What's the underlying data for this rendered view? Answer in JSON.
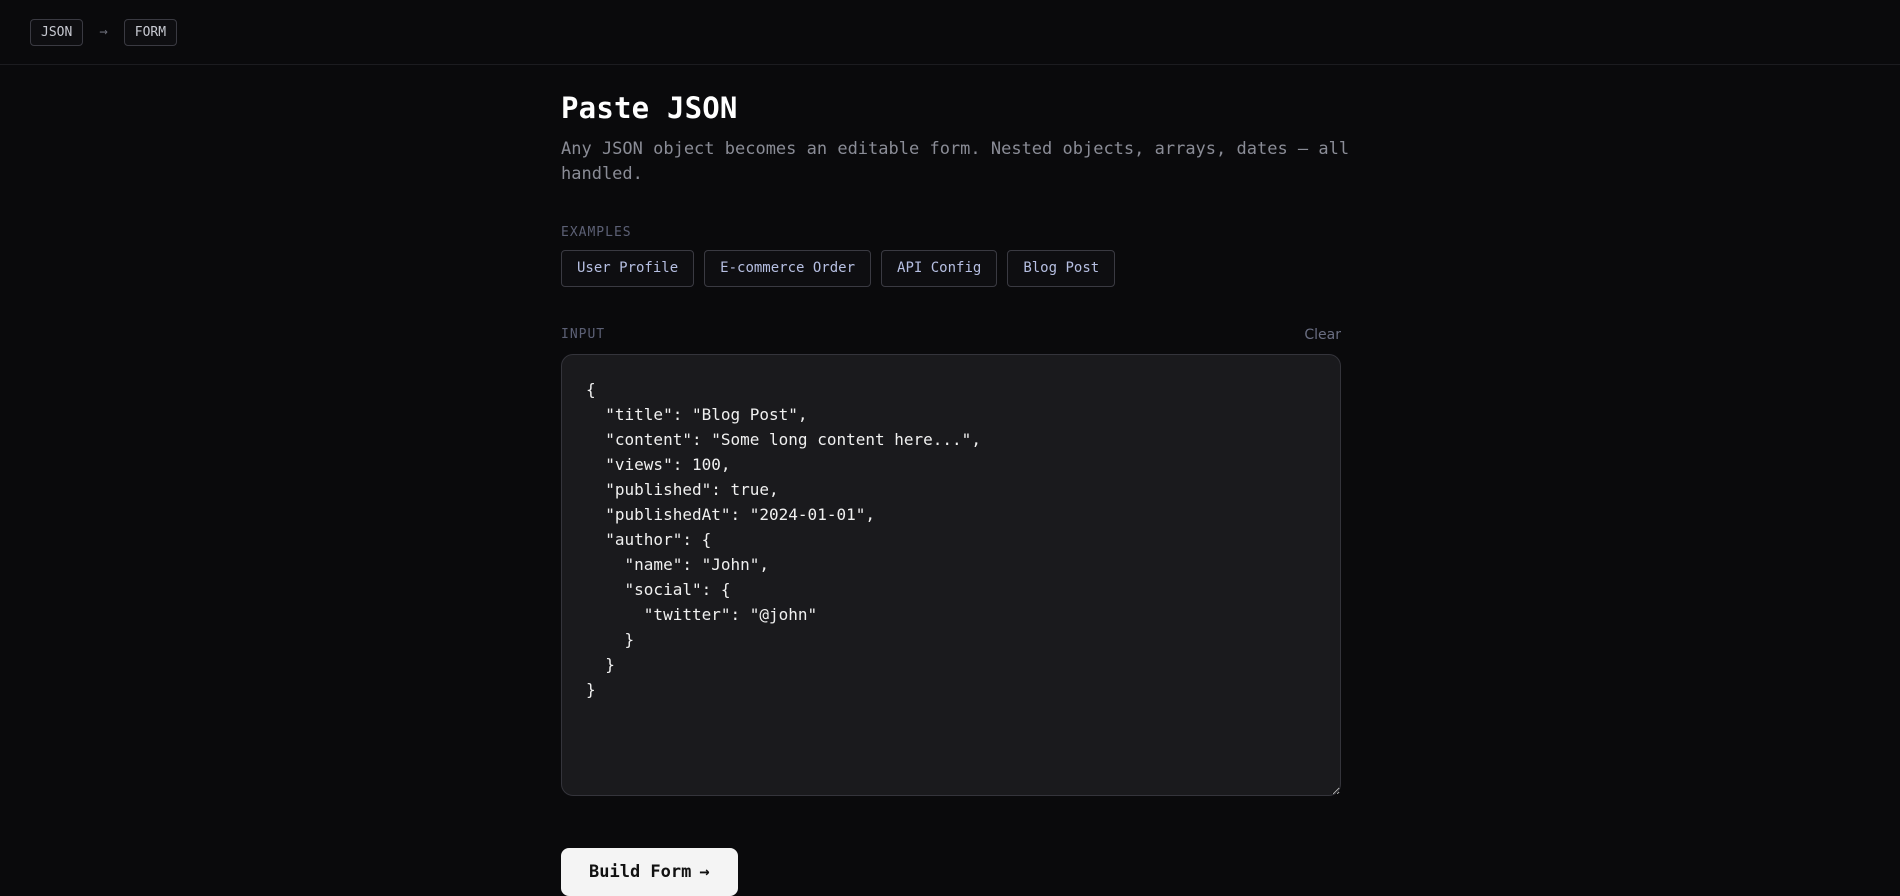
{
  "header": {
    "tag_left": "JSON",
    "arrow": "→",
    "tag_right": "FORM"
  },
  "main": {
    "title": "Paste JSON",
    "subtitle": "Any JSON object becomes an editable form. Nested objects, arrays, dates — all handled.",
    "examples_label": "EXAMPLES",
    "examples": [
      {
        "label": "User Profile"
      },
      {
        "label": "E-commerce Order"
      },
      {
        "label": "API Config"
      },
      {
        "label": "Blog Post"
      }
    ],
    "input_label": "INPUT",
    "clear_label": "Clear",
    "input_value": "{\n  \"title\": \"Blog Post\",\n  \"content\": \"Some long content here...\",\n  \"views\": 100,\n  \"published\": true,\n  \"publishedAt\": \"2024-01-01\",\n  \"author\": {\n    \"name\": \"John\",\n    \"social\": {\n      \"twitter\": \"@john\"\n    }\n  }\n}",
    "build_button": {
      "label": "Build Form",
      "icon": "→"
    }
  }
}
